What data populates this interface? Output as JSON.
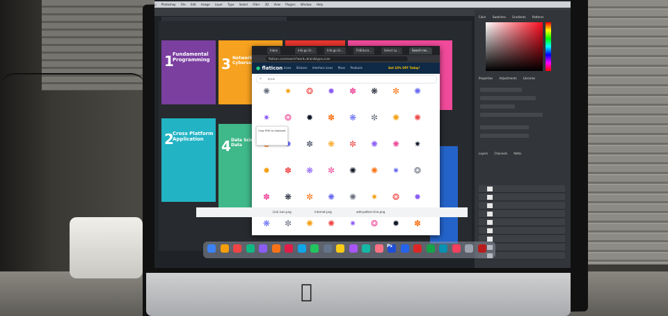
{
  "menubar": [
    "Photoshop",
    "File",
    "Edit",
    "Image",
    "Layer",
    "Type",
    "Select",
    "Filter",
    "3D",
    "View",
    "Plugins",
    "Window",
    "Help"
  ],
  "photoshop": {
    "color_tabs": [
      "Color",
      "Swatches",
      "Gradients",
      "Patterns"
    ],
    "props_tabs": [
      "Properties",
      "Adjustments",
      "Libraries"
    ],
    "layer_tabs": [
      "Layers",
      "Channels",
      "Paths"
    ]
  },
  "cards": [
    {
      "title": "Fundamental Programming",
      "number": "1"
    },
    {
      "title": "Network Sys & Cybersecurity",
      "number": "3"
    },
    {
      "title": "Cross Platform Application",
      "number": "2"
    },
    {
      "title": "Data Science & Big Data",
      "number": "4"
    }
  ],
  "browser": {
    "tabs": [
      "Inbox",
      "Info.go Gr...",
      "Info.go Gr...",
      "FI4Educa...",
      "Select Lo...",
      "Search res..."
    ],
    "url": "flaticon.com/search?word=brain&type=icon",
    "logo": "flaticon",
    "nav": [
      "Icons",
      "Stickers",
      "Interface icons",
      "Plans",
      "Products"
    ],
    "promo": "Get 10% OFF Today!",
    "search_placeholder": "brain",
    "tooltip": "Copy PNG to clipboard",
    "downloads": [
      "Link icon.png",
      "internet.png",
      "add-pattern-line.png"
    ]
  },
  "dock_labels": [
    "Ps"
  ],
  "colors": {
    "picker_red": "#ff0c1e",
    "flaticon_header": "#0e2a47",
    "flaticon_green": "#22d17f",
    "card_purple": "#7b3fa0",
    "card_orange": "#f6a11f",
    "card_red": "#e6362d",
    "card_pink": "#f04a9a",
    "card_teal": "#22b3c4",
    "card_green": "#3fb88a",
    "card_blue": "#2463c9"
  }
}
